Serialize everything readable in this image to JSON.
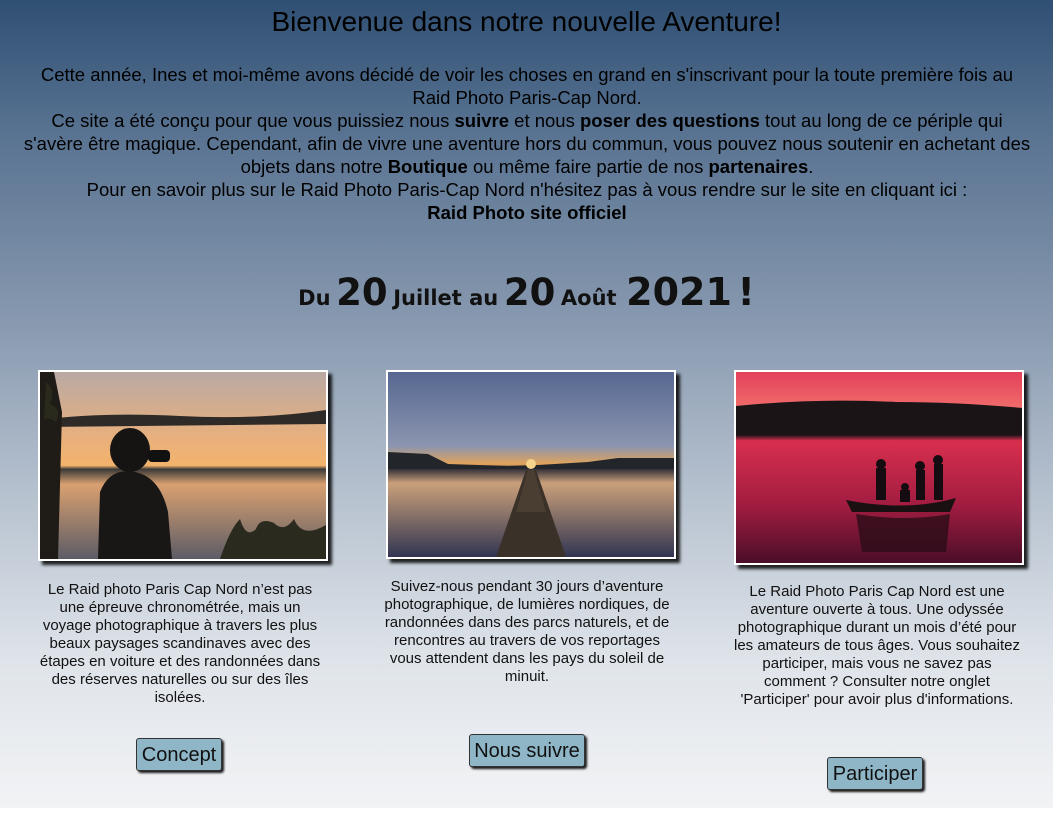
{
  "header": {
    "title": "Bienvenue dans notre nouvelle Aventure!"
  },
  "intro": {
    "line1": "Cette année, Ines et moi-même avons décidé de voir les choses en grand en s'inscrivant pour la toute première fois au Raid Photo Paris-Cap Nord.",
    "p2_a": "Ce site a été conçu pour que vous puissiez nous ",
    "p2_b": "suivre",
    "p2_c": " et nous ",
    "p2_d": "poser des questions",
    "p2_e": " tout au long de ce périple qui s'avère être magique. Cependant, afin de vivre une aventure hors du commun, vous pouvez nous soutenir en achetant des objets dans notre ",
    "p2_f": "Boutique",
    "p2_g": " ou même faire partie de nos ",
    "p2_h": "partenaires",
    "p2_i": ".",
    "line3": "Pour en savoir plus sur le Raid Photo Paris-Cap Nord n'hésitez pas à vous rendre sur le site en cliquant ici :",
    "official_link": "Raid Photo site officiel"
  },
  "dates": {
    "du": "Du",
    "day1": "20",
    "month1": "Juillet au",
    "day2": "20",
    "month2": "Août",
    "year": "2021",
    "exclaim": "!"
  },
  "cards": [
    {
      "text": "Le Raid photo Paris Cap Nord n’est pas une épreuve chronométrée, mais un voyage photographique à travers les plus beaux paysages scandinaves avec des étapes en voiture et des randonnées dans des réserves naturelles ou sur des îles isolées.",
      "button": "Concept"
    },
    {
      "text": "Suivez-nous pendant 30 jours d’aventure photographique, de lumières nordiques, de randonnées dans des parcs naturels, et de rencontres au travers de vos reportages vous attendent dans les pays du soleil de minuit.",
      "button": "Nous suivre"
    },
    {
      "text": "Le Raid Photo Paris Cap Nord est une aventure ouverte à tous. Une odyssée photographique durant un mois d’été pour les amateurs de tous âges. Vous souhaitez participer, mais vous ne savez pas comment ? Consulter notre onglet 'Participer' pour avoir plus d'informations.",
      "button": "Participer"
    }
  ],
  "colors": {
    "button_bg": "#8fb6c6",
    "gradient_top": "#2f4f73",
    "gradient_bottom": "#f2f3f5"
  }
}
